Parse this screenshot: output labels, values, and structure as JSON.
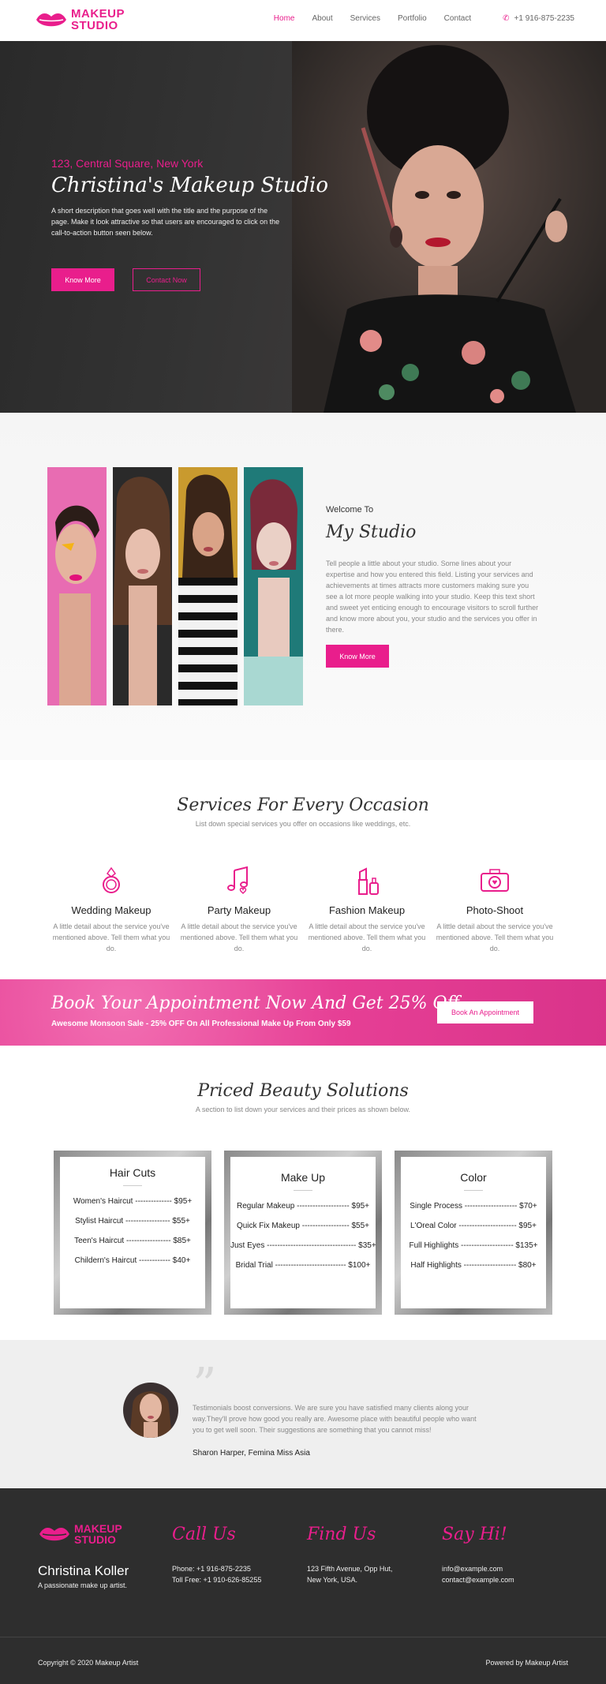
{
  "brand": {
    "logo_text_line1": "MAKEUP",
    "logo_text_line2": "STUDIO",
    "accent": "#e91e8c"
  },
  "nav": {
    "items": [
      "Home",
      "About",
      "Services",
      "Portfolio",
      "Contact"
    ],
    "active": "Home",
    "phone": "+1 916-875-2235"
  },
  "hero": {
    "location": "123, Central Square, New York",
    "title": "Christina's Makeup Studio",
    "description": "A short description that goes well with the title and the purpose of the page. Make it look attractive so that users are encouraged to click on the call-to-action button seen below.",
    "primary_button": "Know More",
    "secondary_button": "Contact Now"
  },
  "studio": {
    "welcome": "Welcome To",
    "title": "My Studio",
    "text": "Tell people a little about your studio. Some lines about your expertise and how you entered this field. Listing your services and achievements at times attracts more customers making sure you see a lot more people walking into your studio. Keep this text short and sweet yet enticing enough to encourage visitors to scroll further and know more about you, your studio and the services you offer in there.",
    "button": "Know More"
  },
  "services": {
    "title": "Services For Every Occasion",
    "subtitle": "List down special services you offer on occasions like weddings, etc.",
    "items": [
      {
        "name": "Wedding Makeup",
        "icon": "ring-icon",
        "desc": "A little detail about the service you've mentioned above. Tell them what you do."
      },
      {
        "name": "Party Makeup",
        "icon": "music-icon",
        "desc": "A little detail about the service you've mentioned above. Tell them what you do."
      },
      {
        "name": "Fashion Makeup",
        "icon": "lipstick-icon",
        "desc": "A little detail about the service you've mentioned above. Tell them what you do."
      },
      {
        "name": "Photo-Shoot",
        "icon": "camera-icon",
        "desc": "A little detail about the service you've mentioned above. Tell them what you do."
      }
    ]
  },
  "banner": {
    "title": "Book Your Appointment Now And Get 25% Off",
    "subtitle": "Awesome Monsoon Sale - 25% OFF On All Professional Make Up From Only $59",
    "button": "Book An Appointment"
  },
  "pricing": {
    "title": "Priced Beauty Solutions",
    "subtitle": "A section to list down your services and their prices as shown below.",
    "cards": [
      {
        "title": "Hair Cuts",
        "rows": [
          "Women's Haircut -------------- $95+",
          "Stylist Haircut ----------------- $55+",
          "Teen's Haircut ----------------- $85+",
          "Childern's Haircut ------------ $40+"
        ]
      },
      {
        "title": "Make Up",
        "rows": [
          "Regular Makeup -------------------- $95+",
          "Quick Fix Makeup ------------------ $55+",
          "Just Eyes ---------------------------------- $35+",
          "Bridal Trial --------------------------- $100+"
        ]
      },
      {
        "title": "Color",
        "rows": [
          "Single Process -------------------- $70+",
          "L'Oreal Color ---------------------- $95+",
          "Full Highlights -------------------- $135+",
          "Half Highlights -------------------- $80+"
        ]
      }
    ]
  },
  "testimonial": {
    "quote_mark": "”",
    "text": "Testimonials boost conversions. We are sure you have satisfied many clients along your way.They'll prove how good you really are. Awesome place with beautiful people who want you to get well soon. Their suggestions are something that you cannot miss!",
    "author": "Sharon Harper, Femina Miss Asia"
  },
  "footer": {
    "name": "Christina Koller",
    "tagline": "A passionate make up artist.",
    "call": {
      "title": "Call Us",
      "lines": [
        "Phone: +1 916-875-2235",
        "Toll Free: +1 910-626-85255"
      ]
    },
    "find": {
      "title": "Find Us",
      "lines": [
        "123 Fifth Avenue, Opp Hut,",
        "New York, USA."
      ]
    },
    "say": {
      "title": "Say Hi!",
      "lines": [
        "info@example.com",
        "contact@example.com"
      ]
    },
    "copyright": "Copyright © 2020 Makeup Artist",
    "powered": "Powered by Makeup Artist"
  }
}
